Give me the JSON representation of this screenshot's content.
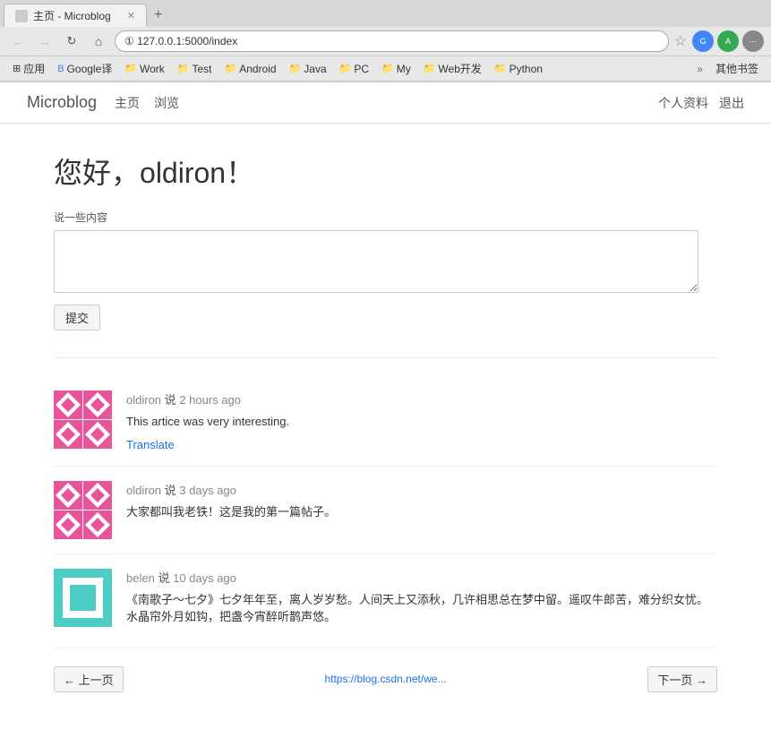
{
  "browser": {
    "tab": {
      "title": "主页 - Microblog",
      "favicon": "🌐"
    },
    "address": "127.0.0.1:5000/index",
    "address_full": "① 127.0.0.1:5000/index"
  },
  "bookmarks": [
    {
      "id": "apps",
      "label": "应用",
      "icon": "⊞"
    },
    {
      "id": "google-translate",
      "label": "Google译",
      "icon": "📄",
      "color": "#4285f4"
    },
    {
      "id": "work",
      "label": "Work",
      "icon": "📁",
      "color": "#e8a000"
    },
    {
      "id": "test",
      "label": "Test",
      "icon": "📁",
      "color": "#e8a000"
    },
    {
      "id": "android",
      "label": "Android",
      "icon": "📁",
      "color": "#e8a000"
    },
    {
      "id": "java",
      "label": "Java",
      "icon": "📁",
      "color": "#e8a000"
    },
    {
      "id": "pc",
      "label": "PC",
      "icon": "📁",
      "color": "#e8a000"
    },
    {
      "id": "my",
      "label": "My",
      "icon": "📁",
      "color": "#e8a000"
    },
    {
      "id": "webdev",
      "label": "Web开发",
      "icon": "📁",
      "color": "#e8a000"
    },
    {
      "id": "python",
      "label": "Python",
      "icon": "📁",
      "color": "#e8a000"
    }
  ],
  "nav": {
    "logo": "Microblog",
    "links": [
      {
        "id": "home",
        "label": "主页"
      },
      {
        "id": "browse",
        "label": "浏览"
      }
    ],
    "right_links": [
      {
        "id": "profile",
        "label": "个人资料"
      },
      {
        "id": "logout",
        "label": "退出"
      }
    ]
  },
  "greeting": {
    "prefix": "您好，",
    "username": "oldiron",
    "suffix": "！"
  },
  "form": {
    "label": "说一些内容",
    "placeholder": "",
    "submit_label": "提交"
  },
  "posts": [
    {
      "id": "post-1",
      "author": "oldiron",
      "said": "说",
      "time": "2 hours ago",
      "content": "This artice was very interesting.",
      "has_translate": true,
      "translate_label": "Translate",
      "avatar_type": "pink"
    },
    {
      "id": "post-2",
      "author": "oldiron",
      "said": "说",
      "time": "3 days ago",
      "content": "大家都叫我老铁！这是我的第一篇帖子。",
      "has_translate": false,
      "avatar_type": "pink"
    },
    {
      "id": "post-3",
      "author": "belen",
      "said": "说",
      "time": "10 days ago",
      "content": "《南歌子～七夕》七夕年年至，离人岁岁愁。人间天上又添秋，几许相思总在梦中留。遥叹牛郎苦，难分织女忧。水晶帘外月如钩，把盏今宵醉听鹊声悠。",
      "has_translate": false,
      "avatar_type": "teal"
    }
  ],
  "pagination": {
    "prev_label": "← 上一页",
    "next_label": "下一页 →",
    "url_hint": "https://blog.csdn.net/we..."
  }
}
